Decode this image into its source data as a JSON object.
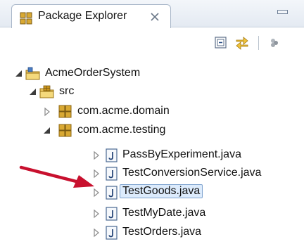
{
  "view": {
    "title": "Package Explorer",
    "icon": "package-explorer-icon",
    "close_icon": "close-icon",
    "minimize_icon": "minimize-icon"
  },
  "toolbar": {
    "buttons": [
      {
        "icon": "collapse-all-icon"
      },
      {
        "icon": "link-with-editor-icon"
      },
      {
        "icon": "view-menu-icon"
      }
    ]
  },
  "tree": {
    "project": {
      "label": "AcmeOrderSystem",
      "icon": "java-project-icon",
      "expanded": true
    },
    "source_folder": {
      "label": "src",
      "icon": "source-folder-icon",
      "expanded": true
    },
    "packages": [
      {
        "label": "com.acme.domain",
        "icon": "package-icon",
        "expanded": false
      },
      {
        "label": "com.acme.testing",
        "icon": "package-icon",
        "expanded": true
      }
    ],
    "files": [
      {
        "label": "PassByExperiment.java",
        "icon": "java-file-icon",
        "selected": false
      },
      {
        "label": "TestConversionService.java",
        "icon": "java-file-icon",
        "selected": false
      },
      {
        "label": "TestGoods.java",
        "icon": "java-file-icon",
        "selected": true
      },
      {
        "label": "TestMyDate.java",
        "icon": "java-file-icon",
        "selected": false
      },
      {
        "label": "TestOrders.java",
        "icon": "java-file-icon",
        "selected": false
      }
    ]
  },
  "colors": {
    "annotation_arrow": "#c8102e",
    "selection_fill": "#dcebfc",
    "selection_border": "#7da2ce",
    "package_icon": "#c9941c"
  }
}
